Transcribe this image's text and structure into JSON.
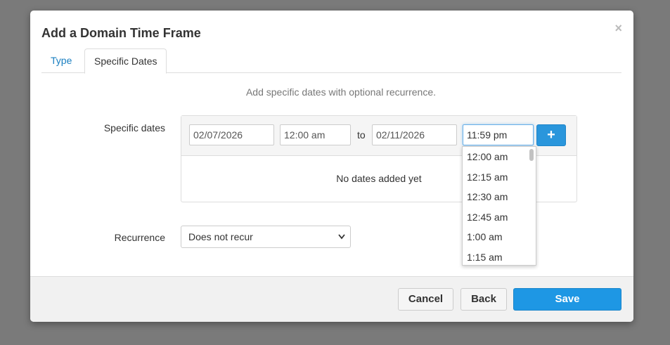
{
  "modal": {
    "title": "Add a Domain Time Frame",
    "close_glyph": "×"
  },
  "tabs": [
    {
      "label": "Type"
    },
    {
      "label": "Specific Dates"
    }
  ],
  "help_text": "Add specific dates with optional recurrence.",
  "specific_dates": {
    "label": "Specific dates",
    "start_date": "02/07/2026",
    "start_time": "12:00 am",
    "to_label": "to",
    "end_date": "02/11/2026",
    "end_time": "11:59 pm",
    "add_glyph": "+",
    "empty_message": "No dates added yet"
  },
  "time_dropdown": {
    "options": [
      "12:00 am",
      "12:15 am",
      "12:30 am",
      "12:45 am",
      "1:00 am",
      "1:15 am"
    ]
  },
  "recurrence": {
    "label": "Recurrence",
    "selected": "Does not recur",
    "caret_glyph": "⌄"
  },
  "footer": {
    "cancel_label": "Cancel",
    "back_label": "Back",
    "save_label": "Save"
  },
  "colors": {
    "accent": "#1e97e4",
    "link": "#1a7fc1",
    "overlay": "#7a7a7a"
  }
}
